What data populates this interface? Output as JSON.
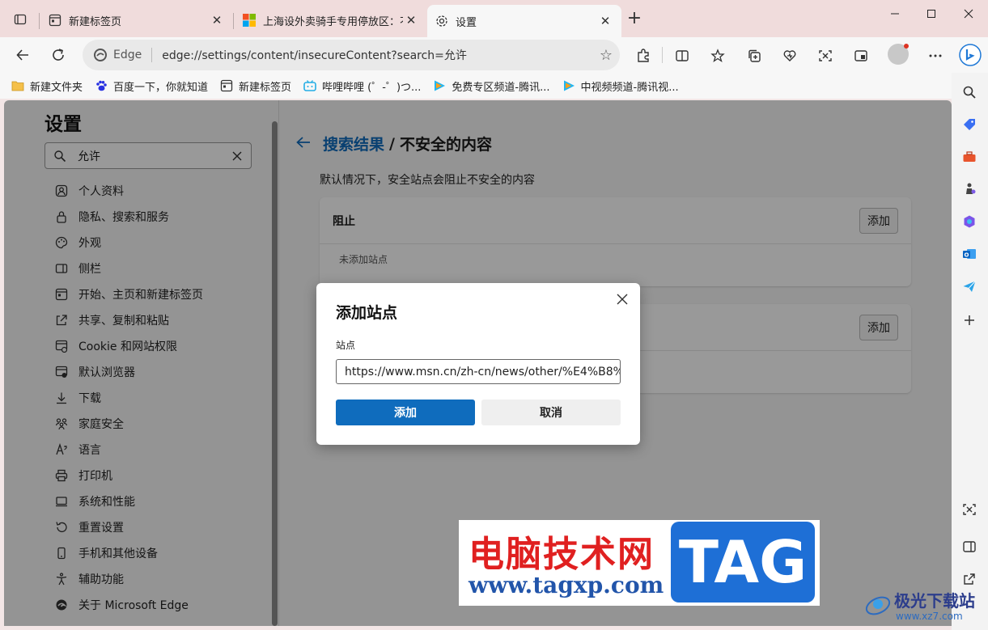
{
  "tabs": [
    {
      "title": "新建标签页",
      "icon": "newtab-page-icon"
    },
    {
      "title": "上海设外卖骑手专用停放区：不韦",
      "icon": "microsoft-logo-icon"
    },
    {
      "title": "设置",
      "icon": "gear-icon"
    }
  ],
  "address": {
    "site_label": "Edge",
    "url": "edge://settings/content/insecureContent?search=允许"
  },
  "bookmarks": [
    {
      "label": "新建文件夹",
      "icon": "folder-icon"
    },
    {
      "label": "百度一下，你就知道",
      "icon": "baidu-paw-icon"
    },
    {
      "label": "新建标签页",
      "icon": "newtab-page-icon"
    },
    {
      "label": "哔哩哔哩 (゜-゜)つ...",
      "icon": "bilibili-icon"
    },
    {
      "label": "免费专区频道-腾讯...",
      "icon": "tencent-video-icon"
    },
    {
      "label": "中视频频道-腾讯视...",
      "icon": "tencent-video-icon"
    }
  ],
  "settings": {
    "title": "设置",
    "search_value": "允许",
    "nav": [
      {
        "label": "个人资料",
        "icon": "profile-icon"
      },
      {
        "label": "隐私、搜索和服务",
        "icon": "lock-icon"
      },
      {
        "label": "外观",
        "icon": "palette-icon"
      },
      {
        "label": "侧栏",
        "icon": "sidebar-icon"
      },
      {
        "label": "开始、主页和新建标签页",
        "icon": "home-icon"
      },
      {
        "label": "共享、复制和粘贴",
        "icon": "share-icon"
      },
      {
        "label": "Cookie 和网站权限",
        "icon": "cookie-icon"
      },
      {
        "label": "默认浏览器",
        "icon": "browser-icon"
      },
      {
        "label": "下载",
        "icon": "download-icon"
      },
      {
        "label": "家庭安全",
        "icon": "family-icon"
      },
      {
        "label": "语言",
        "icon": "language-icon"
      },
      {
        "label": "打印机",
        "icon": "printer-icon"
      },
      {
        "label": "系统和性能",
        "icon": "system-icon"
      },
      {
        "label": "重置设置",
        "icon": "reset-icon"
      },
      {
        "label": "手机和其他设备",
        "icon": "phone-icon"
      },
      {
        "label": "辅助功能",
        "icon": "accessibility-icon"
      },
      {
        "label": "关于 Microsoft Edge",
        "icon": "edge-logo-icon"
      }
    ]
  },
  "main": {
    "crumb_link": "搜索结果",
    "crumb_sep": "/",
    "crumb_current": "不安全的内容",
    "description": "默认情况下，安全站点会阻止不安全的内容",
    "block_title": "阻止",
    "block_add": "添加",
    "block_empty": "未添加站点",
    "allow_add": "添加"
  },
  "dialog": {
    "title": "添加站点",
    "field_label": "站点",
    "field_value": "https://www.msn.cn/zh-cn/news/other/%E4%B8%8",
    "add_label": "添加",
    "cancel_label": "取消"
  },
  "watermark": {
    "cn_text": "电脑技术网",
    "url_text": "www.tagxp.com",
    "tag_text": "TAG",
    "corner_name": "极光下载站",
    "corner_url": "www.xz7.com"
  },
  "colors": {
    "accent": "#0f6cbd",
    "titlebar": "#f0dcdc"
  }
}
